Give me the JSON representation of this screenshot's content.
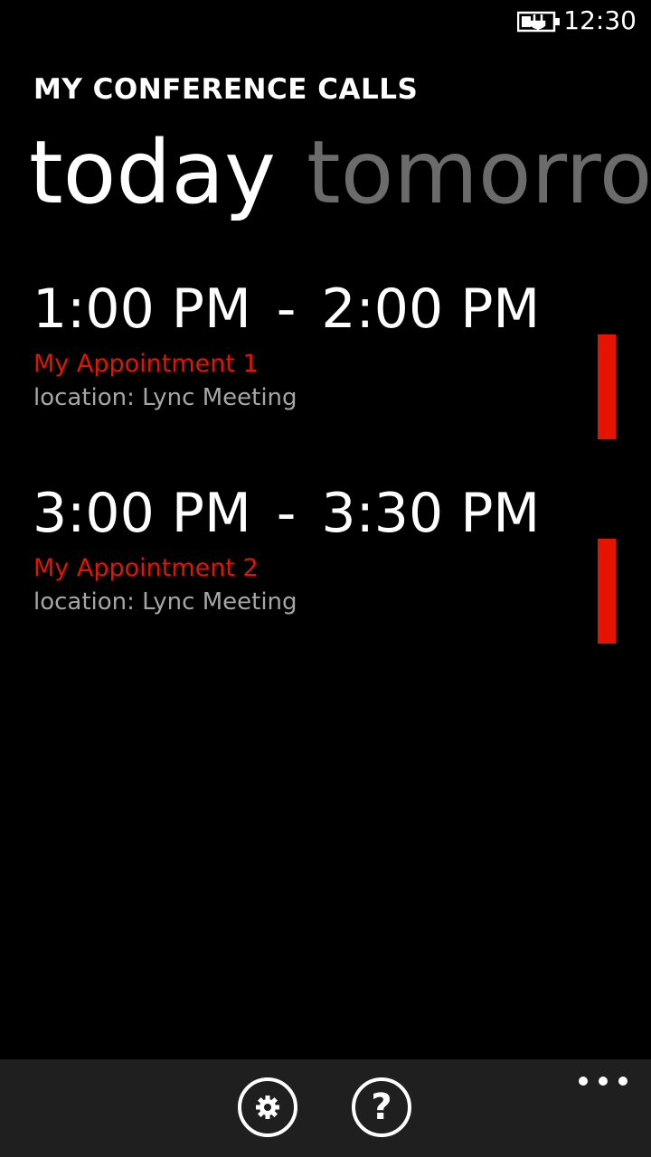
{
  "status_bar": {
    "time": "12:30",
    "battery_icon": "battery-charging-icon"
  },
  "app": {
    "title": "MY CONFERENCE CALLS"
  },
  "pivot": {
    "items": [
      {
        "label": "today",
        "active": true
      },
      {
        "label": "tomorrow",
        "active": false
      }
    ]
  },
  "appointments": [
    {
      "start": "1:00 PM",
      "separator": "-",
      "end": "2:00 PM",
      "title": "My Appointment 1",
      "location": "location: Lync Meeting"
    },
    {
      "start": "3:00 PM",
      "separator": "-",
      "end": "3:30 PM",
      "title": "My Appointment 2",
      "location": "location: Lync Meeting"
    }
  ],
  "app_bar": {
    "buttons": [
      {
        "icon": "gear-icon"
      },
      {
        "icon": "help-icon",
        "glyph": "?"
      }
    ],
    "more_icon": "more-ellipsis-icon"
  },
  "colors": {
    "accent": "#e51400",
    "background": "#000000",
    "app_bar": "#1f1f1f",
    "inactive_pivot": "#6b6b6b",
    "secondary_text": "#a6a6a6"
  }
}
